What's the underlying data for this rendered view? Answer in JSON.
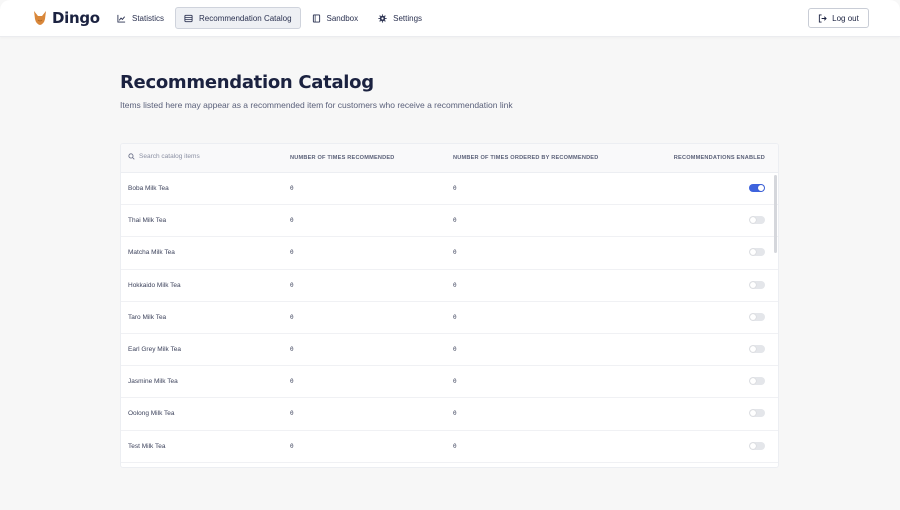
{
  "app": {
    "name": "Dingo"
  },
  "nav": {
    "items": [
      {
        "label": "Statistics",
        "icon": "chart-icon",
        "active": false
      },
      {
        "label": "Recommendation Catalog",
        "icon": "catalog-icon",
        "active": true
      },
      {
        "label": "Sandbox",
        "icon": "book-icon",
        "active": false
      },
      {
        "label": "Settings",
        "icon": "gear-icon",
        "active": false
      }
    ],
    "logout_label": "Log out"
  },
  "page": {
    "title": "Recommendation Catalog",
    "subtitle": "Items listed here may appear as a recommended item for customers who receive a recommendation link"
  },
  "table": {
    "search_placeholder": "Search catalog items",
    "columns": [
      "NUMBER OF TIMES RECOMMENDED",
      "NUMBER OF TIMES ORDERED BY RECOMMENDED",
      "RECOMMENDATIONS ENABLED"
    ],
    "rows": [
      {
        "name": "Boba Milk Tea",
        "recommended": "0",
        "ordered": "0",
        "enabled": true
      },
      {
        "name": "Thai Milk Tea",
        "recommended": "0",
        "ordered": "0",
        "enabled": false
      },
      {
        "name": "Matcha Milk Tea",
        "recommended": "0",
        "ordered": "0",
        "enabled": false
      },
      {
        "name": "Hokkaido Milk Tea",
        "recommended": "0",
        "ordered": "0",
        "enabled": false
      },
      {
        "name": "Taro Milk Tea",
        "recommended": "0",
        "ordered": "0",
        "enabled": false
      },
      {
        "name": "Earl Grey Milk Tea",
        "recommended": "0",
        "ordered": "0",
        "enabled": false
      },
      {
        "name": "Jasmine Milk Tea",
        "recommended": "0",
        "ordered": "0",
        "enabled": false
      },
      {
        "name": "Oolong Milk Tea",
        "recommended": "0",
        "ordered": "0",
        "enabled": false
      },
      {
        "name": "Test Milk Tea",
        "recommended": "0",
        "ordered": "0",
        "enabled": false
      }
    ]
  },
  "colors": {
    "accent": "#3e63dd",
    "logo": "#d9873a",
    "text": "#1b2240"
  }
}
